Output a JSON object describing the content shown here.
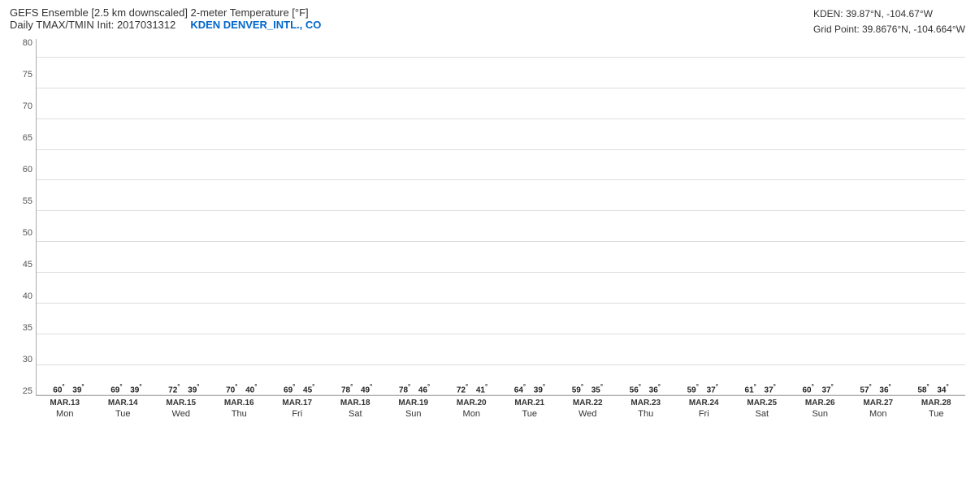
{
  "header": {
    "title": "GEFS Ensemble [2.5 km downscaled] 2-meter Temperature [°F]",
    "subtitle": "Daily TMAX/TMIN Init: 2017031312",
    "station": "KDEN DENVER_INTL., CO",
    "info_line1": "KDEN: 39.87°N, -104.67°W",
    "info_line2": "Grid Point: 39.8676°N, -104.664°W"
  },
  "yaxis": {
    "labels": [
      "80",
      "75",
      "70",
      "65",
      "60",
      "55",
      "50",
      "45",
      "40",
      "35",
      "30",
      "25"
    ],
    "min": 25,
    "max": 83,
    "range": 58
  },
  "days": [
    {
      "date": "MAR.13",
      "day": "Mon",
      "tmax": 60,
      "tmin": 39
    },
    {
      "date": "MAR.14",
      "day": "Tue",
      "tmax": 69,
      "tmin": 39
    },
    {
      "date": "MAR.15",
      "day": "Wed",
      "tmax": 72,
      "tmin": 39
    },
    {
      "date": "MAR.16",
      "day": "Thu",
      "tmax": 70,
      "tmin": 40
    },
    {
      "date": "MAR.17",
      "day": "Fri",
      "tmax": 69,
      "tmin": 45
    },
    {
      "date": "MAR.18",
      "day": "Sat",
      "tmax": 78,
      "tmin": 49
    },
    {
      "date": "MAR.19",
      "day": "Sun",
      "tmax": 78,
      "tmin": 46
    },
    {
      "date": "MAR.20",
      "day": "Mon",
      "tmax": 72,
      "tmin": 41
    },
    {
      "date": "MAR.21",
      "day": "Tue",
      "tmax": 64,
      "tmin": 39
    },
    {
      "date": "MAR.22",
      "day": "Wed",
      "tmax": 59,
      "tmin": 35
    },
    {
      "date": "MAR.23",
      "day": "Thu",
      "tmax": 56,
      "tmin": 36
    },
    {
      "date": "MAR.24",
      "day": "Fri",
      "tmax": 59,
      "tmin": 37
    },
    {
      "date": "MAR.25",
      "day": "Sat",
      "tmax": 61,
      "tmin": 37
    },
    {
      "date": "MAR.26",
      "day": "Sun",
      "tmax": 60,
      "tmin": 37
    },
    {
      "date": "MAR.27",
      "day": "Mon",
      "tmax": 57,
      "tmin": 36
    },
    {
      "date": "MAR.28",
      "day": "Tue",
      "tmax": 58,
      "tmin": 34
    }
  ]
}
